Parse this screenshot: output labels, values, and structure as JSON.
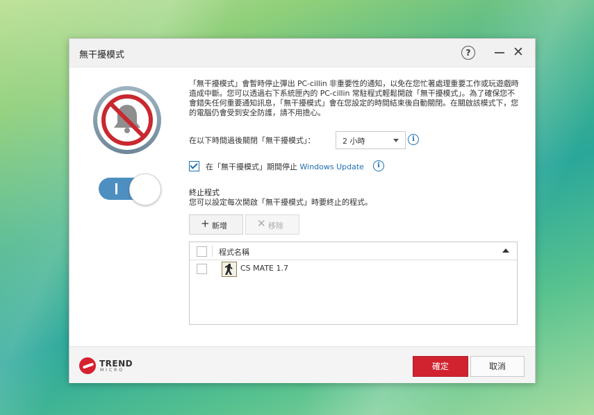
{
  "dialog": {
    "title": "無干擾模式",
    "help_label": "?",
    "close_label": "✕"
  },
  "toggle": {
    "state": "on"
  },
  "description": "「無干擾模式」會暫時停止彈出 PC-cillin 非重要性的通知，以免在您忙著處理重要工作或玩遊戲時造成中斷。您可以透過右下系統匣內的 PC-cillin 常駐程式輕鬆開啟「無干擾模式」。為了確保您不會錯失任何重要通知訊息，「無干擾模式」會在您設定的時間結束後自動關閉。在關啟該模式下，您的電腦仍會受到安全防護，請不用擔心。",
  "timer": {
    "label": "在以下時間過後關閉「無干擾模式」：",
    "value": "2 小時"
  },
  "windows_update": {
    "checked": true,
    "label_prefix": "在「無干擾模式」期間停止 ",
    "label_link": "Windows Update"
  },
  "programs": {
    "title": "終止程式",
    "subtitle": "您可以設定每次開啟「無干擾模式」時要終止的程式。",
    "add_icon": "+",
    "add_label": "新增",
    "remove_icon": "✕",
    "remove_label": "移除",
    "column_header": "程式名稱",
    "rows": [
      {
        "name": "CS MATE 1.7"
      }
    ]
  },
  "footer": {
    "logo_word": "TREND",
    "logo_sub": "MICRO",
    "ok_label": "確定",
    "cancel_label": "取消"
  },
  "icons": {
    "hero": "bell-muted-icon",
    "info": "info-icon",
    "app": "counter-strike-icon"
  },
  "colors": {
    "accent": "#d0232f",
    "toggle": "#4d8fc0",
    "link": "#1d6fb2"
  }
}
